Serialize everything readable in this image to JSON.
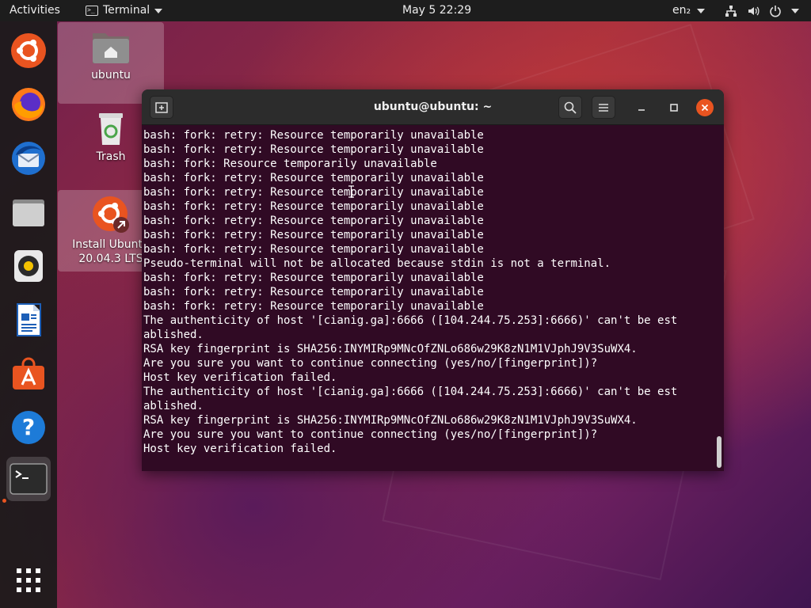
{
  "topbar": {
    "activities": "Activities",
    "app_name": "Terminal",
    "clock": "May 5  22:29",
    "language": "en₂"
  },
  "dock": {
    "items": [
      "ubuntu-software-center",
      "firefox",
      "thunderbird",
      "files",
      "rhythmbox",
      "libreoffice-writer",
      "ubuntu-software",
      "help",
      "terminal",
      "show-applications"
    ]
  },
  "desktop": {
    "home_label": "ubuntu",
    "trash_label": "Trash",
    "installer_label_1": "Install Ubuntu",
    "installer_label_2": "20.04.3 LTS"
  },
  "terminal": {
    "title": "ubuntu@ubuntu: ~",
    "lines": [
      "bash: fork: retry: Resource temporarily unavailable",
      "bash: fork: retry: Resource temporarily unavailable",
      "bash: fork: Resource temporarily unavailable",
      "bash: fork: retry: Resource temporarily unavailable",
      "bash: fork: retry: Resource temporarily unavailable",
      "bash: fork: retry: Resource temporarily unavailable",
      "bash: fork: retry: Resource temporarily unavailable",
      "bash: fork: retry: Resource temporarily unavailable",
      "bash: fork: retry: Resource temporarily unavailable",
      "Pseudo-terminal will not be allocated because stdin is not a terminal.",
      "bash: fork: retry: Resource temporarily unavailable",
      "bash: fork: retry: Resource temporarily unavailable",
      "bash: fork: retry: Resource temporarily unavailable",
      "The authenticity of host '[cianig.ga]:6666 ([104.244.75.253]:6666)' can't be est",
      "ablished.",
      "RSA key fingerprint is SHA256:INYMIRp9MNcOfZNLo686w29K8zN1M1VJphJ9V3SuWX4.",
      "Are you sure you want to continue connecting (yes/no/[fingerprint])?",
      "Host key verification failed.",
      "The authenticity of host '[cianig.ga]:6666 ([104.244.75.253]:6666)' can't be est",
      "ablished.",
      "RSA key fingerprint is SHA256:INYMIRp9MNcOfZNLo686w29K8zN1M1VJphJ9V3SuWX4.",
      "Are you sure you want to continue connecting (yes/no/[fingerprint])?",
      "Host key verification failed."
    ]
  },
  "colors": {
    "accent": "#e95420",
    "terminal_bg": "#300a24",
    "titlebar_bg": "#2c2c2c"
  }
}
